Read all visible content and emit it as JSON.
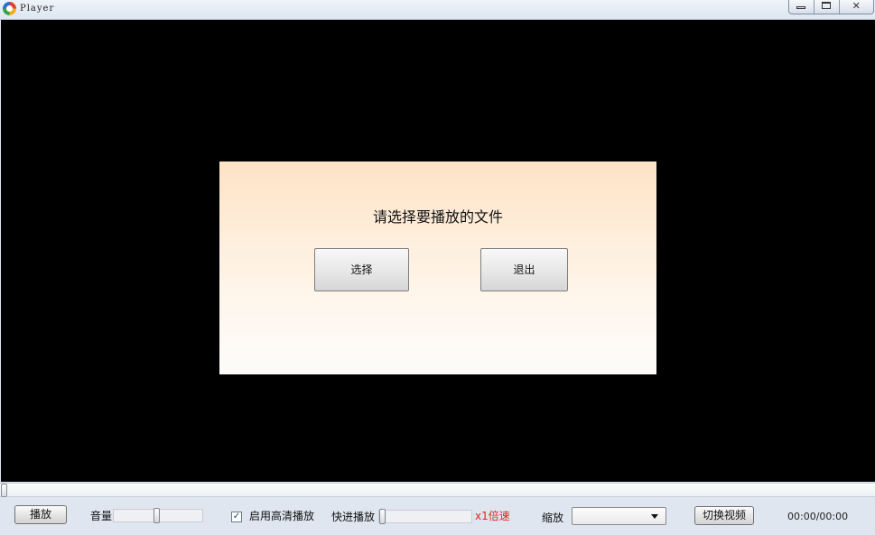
{
  "window": {
    "title": "Player"
  },
  "dialog": {
    "prompt": "请选择要播放的文件",
    "select_label": "选择",
    "exit_label": "退出"
  },
  "progress": {
    "position_fraction": 0.0
  },
  "controls": {
    "play_label": "播放",
    "volume_label": "音量",
    "volume_level": 0.48,
    "hd_label": "启用高清播放",
    "hd_checked": true,
    "fastforward_label": "快进播放",
    "fastforward_level": 0.0,
    "speed_text": "x1倍速",
    "zoom_label": "缩放",
    "zoom_selected": "",
    "switch_label": "切换视频",
    "time_text": "00:00/00:00"
  },
  "colors": {
    "speed_text": "#e0241b",
    "video_bg": "#000000"
  }
}
